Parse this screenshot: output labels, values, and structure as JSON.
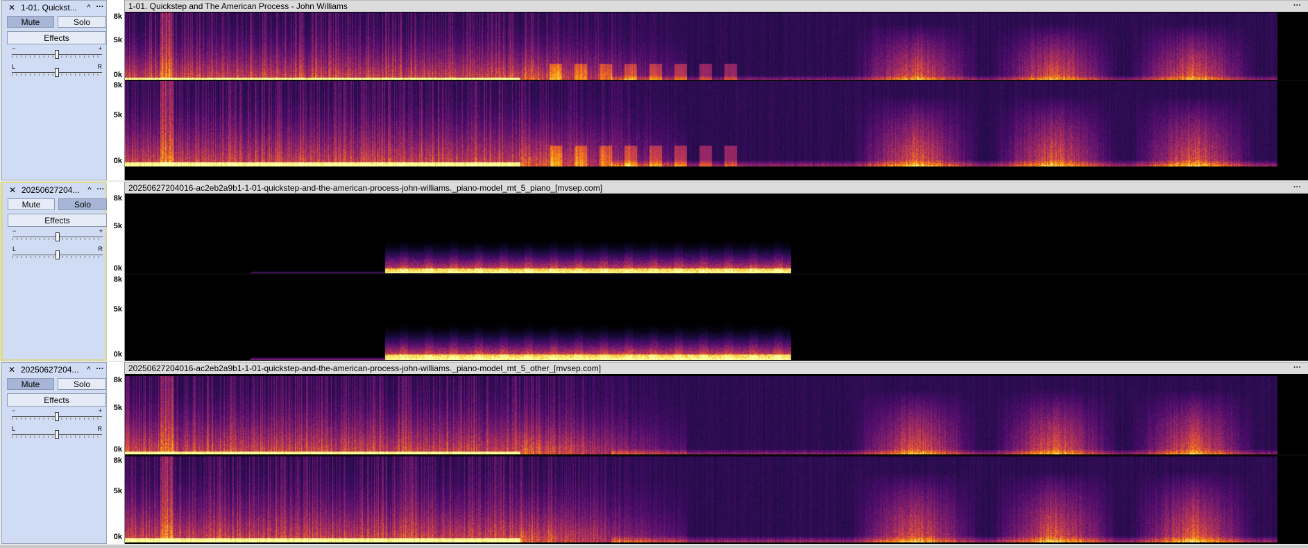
{
  "tracks": [
    {
      "name": "1-01. Quickst...",
      "clip_title": "1-01. Quickstep and The American Process - John Williams",
      "mute_label": "Mute",
      "solo_label": "Solo",
      "effects_label": "Effects",
      "gain_min": "−",
      "gain_max": "+",
      "pan_left": "L",
      "pan_right": "R",
      "mute_on": true,
      "solo_on": false,
      "selected": false,
      "gain_level": 0.5,
      "pan_level": 0.5,
      "freq_labels": [
        "8k",
        "5k",
        "0k"
      ]
    },
    {
      "name": "20250627204...",
      "clip_title": "20250627204016-ac2eb2a9b1-1-01-quickstep-and-the-american-process-john-williams._piano-model_mt_5_piano_[mvsep.com]",
      "mute_label": "Mute",
      "solo_label": "Solo",
      "effects_label": "Effects",
      "gain_min": "−",
      "gain_max": "+",
      "pan_left": "L",
      "pan_right": "R",
      "mute_on": false,
      "solo_on": true,
      "selected": true,
      "gain_level": 0.5,
      "pan_level": 0.5,
      "freq_labels": [
        "8k",
        "5k",
        "0k"
      ]
    },
    {
      "name": "20250627204...",
      "clip_title": "20250627204016-ac2eb2a9b1-1-01-quickstep-and-the-american-process-john-williams._piano-model_mt_5_other_[mvsep.com]",
      "mute_label": "Mute",
      "solo_label": "Solo",
      "effects_label": "Effects",
      "gain_min": "−",
      "gain_max": "+",
      "pan_left": "L",
      "pan_right": "R",
      "mute_on": true,
      "solo_on": false,
      "selected": false,
      "gain_level": 0.5,
      "pan_level": 0.5,
      "freq_labels": [
        "8k",
        "5k",
        "0k"
      ]
    }
  ],
  "icons": {
    "close": "close-icon",
    "collapse": "chevron-up-icon",
    "track_menu": "ellipsis-icon",
    "clip_menu": "ellipsis-icon"
  },
  "glyphs": {
    "close": "✕",
    "collapse": "^",
    "menu": "···"
  },
  "spectrogram_palette": [
    "#000000",
    "#1b0c41",
    "#4a0c6b",
    "#781c6d",
    "#a52c60",
    "#cf4446",
    "#ed6925",
    "#fb9b06",
    "#f7d13d",
    "#fcffa4"
  ]
}
